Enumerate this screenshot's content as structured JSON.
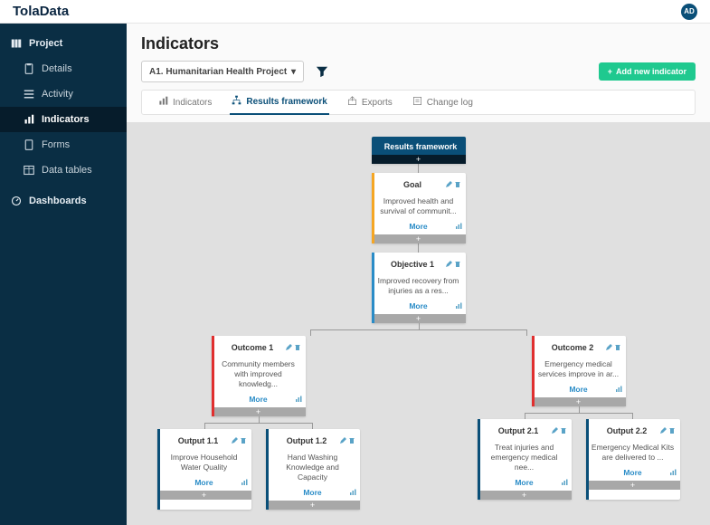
{
  "brand": "TolaData",
  "user_initials": "AD",
  "sidebar": {
    "top": "Project",
    "items": [
      {
        "label": "Details"
      },
      {
        "label": "Activity"
      },
      {
        "label": "Indicators"
      },
      {
        "label": "Forms"
      },
      {
        "label": "Data tables"
      }
    ],
    "dashboards": "Dashboards"
  },
  "page": {
    "title": "Indicators",
    "project_selected": "A1. Humanitarian Health Project",
    "add_button": "Add new indicator"
  },
  "tabs": [
    {
      "label": "Indicators"
    },
    {
      "label": "Results framework"
    },
    {
      "label": "Exports"
    },
    {
      "label": "Change log"
    }
  ],
  "tree": {
    "root": {
      "title": "Results framework"
    },
    "goal": {
      "title": "Goal",
      "body": "Improved health and survival of communit...",
      "more": "More"
    },
    "objective": {
      "title": "Objective 1",
      "body": "Improved recovery from injuries as a res...",
      "more": "More"
    },
    "outcomes": [
      {
        "title": "Outcome 1",
        "body": "Community members with improved knowledg...",
        "more": "More"
      },
      {
        "title": "Outcome 2",
        "body": "Emergency medical services improve in ar...",
        "more": "More"
      }
    ],
    "outputs": [
      {
        "title": "Output 1.1",
        "body": "Improve Household Water Quality",
        "more": "More"
      },
      {
        "title": "Output 1.2",
        "body": "Hand Washing Knowledge and Capacity",
        "more": "More"
      },
      {
        "title": "Output 2.1",
        "body": "Treat injuries and emergency medical nee...",
        "more": "More"
      },
      {
        "title": "Output 2.2",
        "body": "Emergency Medical Kits are delivered to ...",
        "more": "More"
      }
    ]
  },
  "colors": {
    "goal": "#f5a623",
    "objective": "#2a8cc7",
    "outcome": "#e02f2f",
    "output": "#0a4f78"
  }
}
